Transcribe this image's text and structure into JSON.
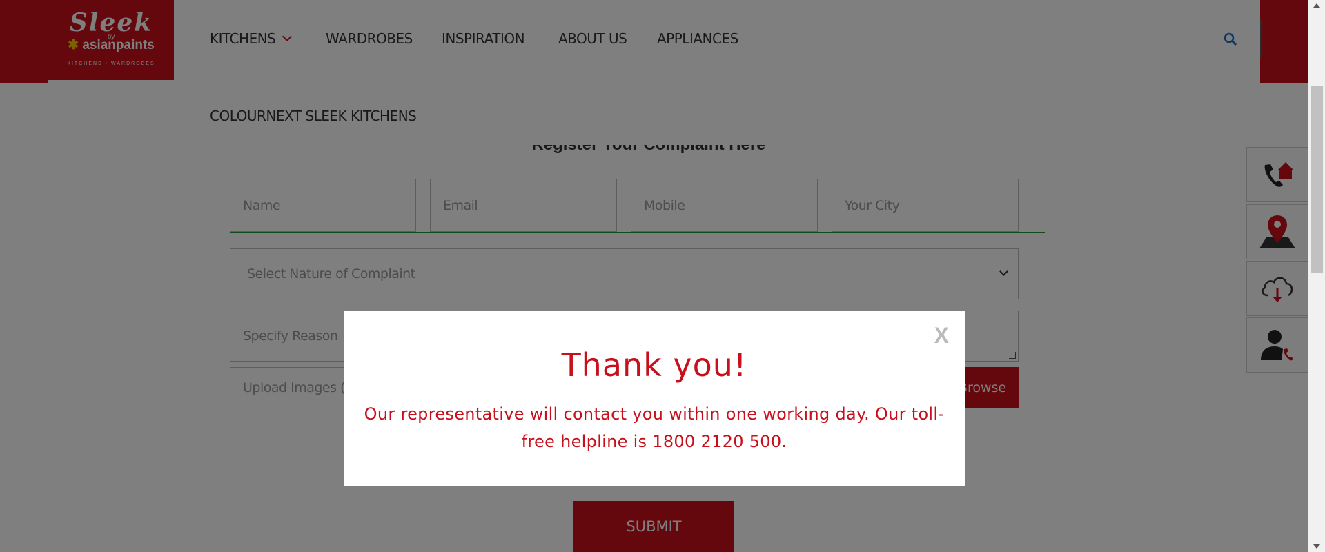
{
  "brand": {
    "logo_main": "Sleek",
    "logo_by": "by",
    "logo_company": "asianpaints",
    "logo_tagline": "KITCHENS • WARDROBES",
    "accent_color": "#c8101c"
  },
  "nav": {
    "items": [
      "KITCHENS",
      "WARDROBES",
      "INSPIRATION",
      "ABOUT US",
      "APPLIANCES"
    ],
    "second_row": "COLOURNEXT SLEEK KITCHENS",
    "search_icon": "search-icon"
  },
  "form": {
    "heading": "Register Your Complaint Here",
    "name_placeholder": "Name",
    "email_placeholder": "Email",
    "mobile_placeholder": "Mobile",
    "city_placeholder": "Your City",
    "complaint_select": "Select Nature of Complaint",
    "reason_placeholder": "Specify Reason",
    "upload_placeholder": "Upload Images (i",
    "browse_label": "Browse",
    "submit_label": "SUBMIT"
  },
  "side_buttons": [
    "home-call-icon",
    "location-pin-icon",
    "cloud-download-icon",
    "user-call-icon"
  ],
  "modal": {
    "close_label": "X",
    "title": "Thank you!",
    "message": "Our representative will contact you within one working day. Our toll-free helpline is 1800 2120 500."
  }
}
